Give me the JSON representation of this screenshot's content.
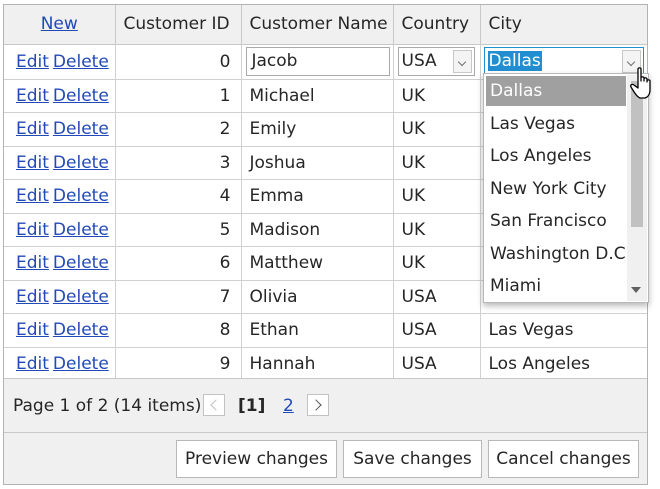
{
  "columns": {
    "new_label": "New",
    "customer_id": "Customer ID",
    "customer_name": "Customer Name",
    "country": "Country",
    "city": "City"
  },
  "commands": {
    "edit": "Edit",
    "delete": "Delete"
  },
  "edit_row": {
    "id": "0",
    "name": "Jacob",
    "country": "USA",
    "city": "Dallas"
  },
  "rows": [
    {
      "id": "1",
      "name": "Michael",
      "country": "UK",
      "city": ""
    },
    {
      "id": "2",
      "name": "Emily",
      "country": "UK",
      "city": ""
    },
    {
      "id": "3",
      "name": "Joshua",
      "country": "UK",
      "city": ""
    },
    {
      "id": "4",
      "name": "Emma",
      "country": "UK",
      "city": ""
    },
    {
      "id": "5",
      "name": "Madison",
      "country": "UK",
      "city": ""
    },
    {
      "id": "6",
      "name": "Matthew",
      "country": "UK",
      "city": ""
    },
    {
      "id": "7",
      "name": "Olivia",
      "country": "USA",
      "city": ""
    },
    {
      "id": "8",
      "name": "Ethan",
      "country": "USA",
      "city": "Las Vegas"
    },
    {
      "id": "9",
      "name": "Hannah",
      "country": "USA",
      "city": "Los Angeles"
    }
  ],
  "pager": {
    "summary": "Page 1 of 2 (14 items)",
    "current": "[1]",
    "page2": "2"
  },
  "footer": {
    "preview": "Preview changes",
    "save": "Save changes",
    "cancel": "Cancel changes"
  },
  "city_dropdown": {
    "selected": "Dallas",
    "options": [
      "Dallas",
      "Las Vegas",
      "Los Angeles",
      "New York City",
      "San Francisco",
      "Washington D.C.",
      "Miami"
    ]
  },
  "colors": {
    "link": "#2149b7",
    "focus": "#228ed1",
    "header_bg": "#f0f0f0",
    "option_selected": "#a0a0a0"
  }
}
